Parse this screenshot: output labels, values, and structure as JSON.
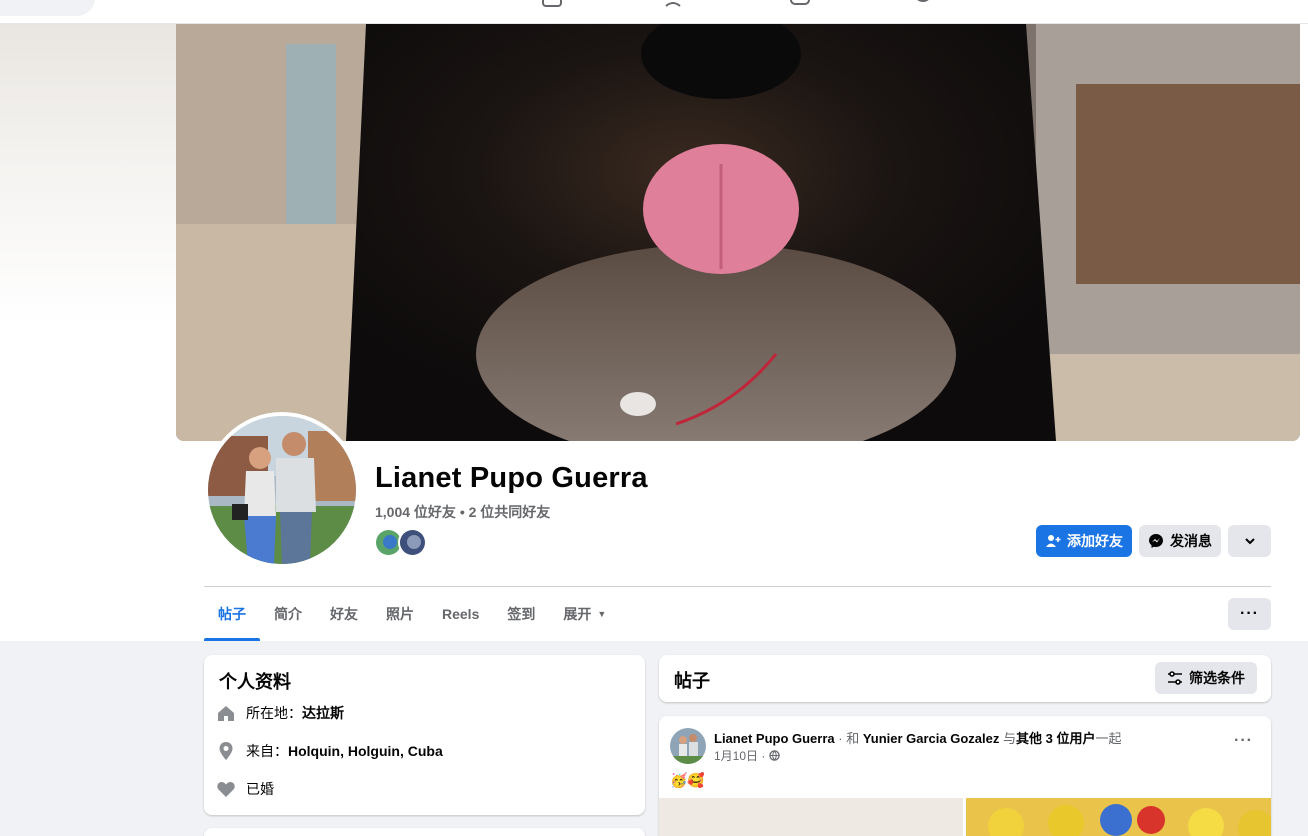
{
  "nav": {
    "icons": [
      "home-icon",
      "friends-icon",
      "video-icon",
      "groups-icon"
    ]
  },
  "profile": {
    "name": "Lianet Pupo Guerra",
    "friends_summary": "1,004 位好友 • 2 位共同好友"
  },
  "actions": {
    "add_friend": "添加好友",
    "message": "发消息"
  },
  "tabs": [
    {
      "label": "帖子",
      "active": true
    },
    {
      "label": "简介"
    },
    {
      "label": "好友"
    },
    {
      "label": "照片"
    },
    {
      "label": "Reels"
    },
    {
      "label": "签到"
    },
    {
      "label": "展开"
    }
  ],
  "intro": {
    "title": "个人资料",
    "lives_prefix": "所在地：",
    "lives_value": "达拉斯",
    "from_prefix": "来自：",
    "from_value": "Holquin, Holguin, Cuba",
    "relationship": "已婚"
  },
  "posts_panel": {
    "title": "帖子",
    "filter_label": "筛选条件"
  },
  "post": {
    "author": "Lianet Pupo Guerra",
    "sep": " · 和 ",
    "tagged": "Yunier Garcia Gozalez",
    "mid": " 与",
    "others": "其他 3 位用户",
    "tail": "一起",
    "date": "1月10日 ·",
    "emoji": "🥳🥰"
  },
  "colors": {
    "primary": "#1b74e4",
    "secondary_text": "#65676b",
    "page_bg": "#f0f2f5"
  }
}
